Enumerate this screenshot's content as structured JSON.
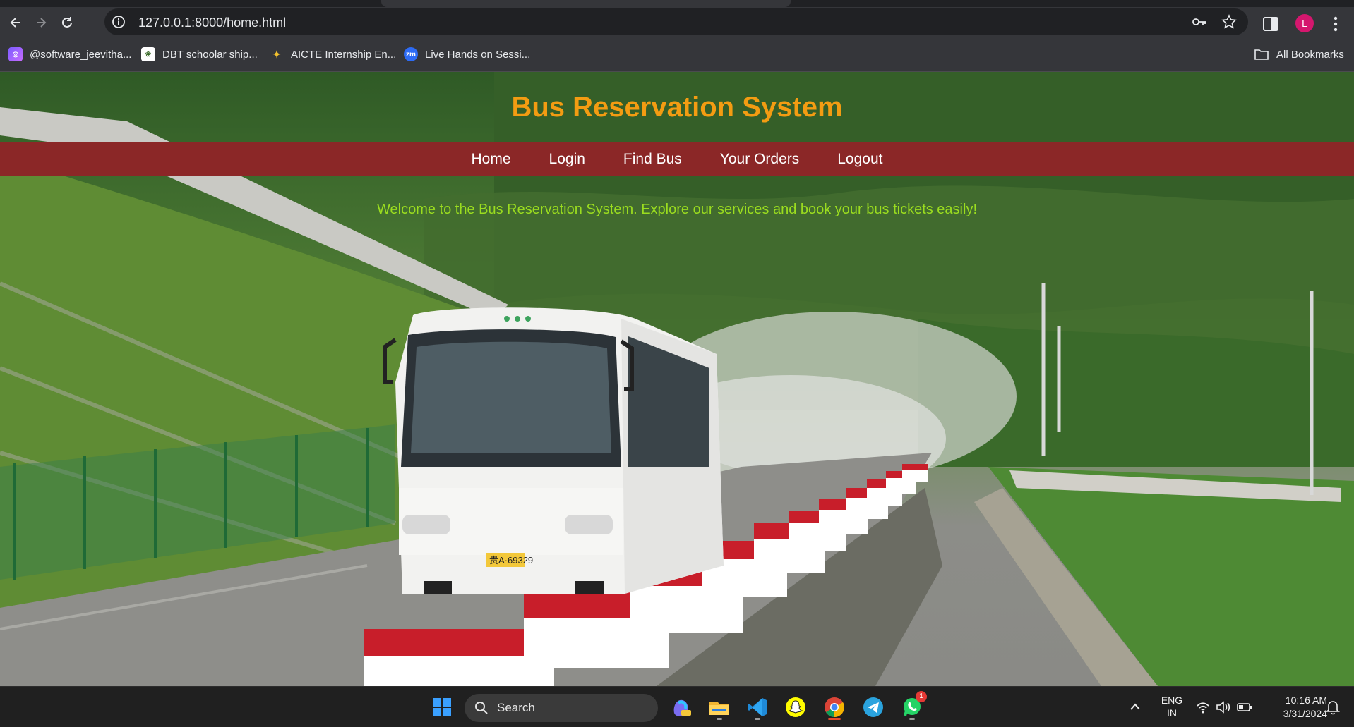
{
  "browser": {
    "url": "127.0.0.1:8000/home.html",
    "profile_initial": "L",
    "bookmarks": [
      {
        "label": "@software_jeevitha...",
        "icon": "instagram-icon"
      },
      {
        "label": "DBT schoolar ship...",
        "icon": "emblem-icon"
      },
      {
        "label": "AICTE Internship En...",
        "icon": "aicte-icon"
      },
      {
        "label": "Live Hands on Sessi...",
        "icon": "zoom-icon"
      }
    ],
    "all_bookmarks_label": "All Bookmarks",
    "zoom_icon_text": "zm"
  },
  "site": {
    "title": "Bus Reservation System",
    "nav": [
      "Home",
      "Login",
      "Find Bus",
      "Your Orders",
      "Logout"
    ],
    "welcome": "Welcome to the Bus Reservation System. Explore our services and book your bus tickets easily!",
    "plate": "贵A·69329"
  },
  "taskbar": {
    "search_label": "Search",
    "apps": [
      "windows-start-icon",
      "copilot-icon",
      "file-explorer-icon",
      "vscode-icon",
      "snapchat-icon",
      "chrome-icon",
      "telegram-icon",
      "whatsapp-icon"
    ],
    "whatsapp_badge": "1",
    "lang_line1": "ENG",
    "lang_line2": "IN",
    "time": "10:16 AM",
    "date": "3/31/2024"
  },
  "colors": {
    "title": "#f39c12",
    "navbar": "#8b2727",
    "welcome": "#9bdd1f"
  }
}
